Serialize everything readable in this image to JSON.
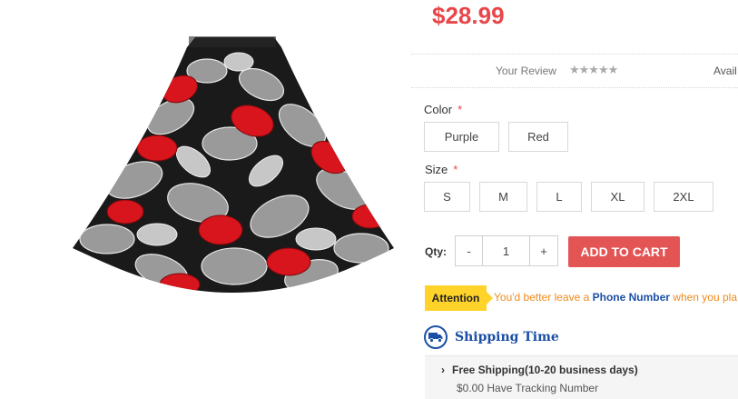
{
  "product": {
    "image_alt": "floral skirt",
    "price": "$28.99",
    "review_label": "Your Review",
    "stars": "★★★★★",
    "availability_prefix": "Avail"
  },
  "options": {
    "color_label": "Color",
    "required_mark": "*",
    "colors": [
      "Purple",
      "Red"
    ],
    "size_label": "Size",
    "sizes": [
      "S",
      "M",
      "L",
      "XL",
      "2XL"
    ]
  },
  "quantity": {
    "label": "Qty:",
    "minus": "-",
    "value": "1",
    "plus": "+"
  },
  "cart": {
    "button_label": "ADD TO CART"
  },
  "attention": {
    "badge": "Attention",
    "text_before": "You'd better leave a ",
    "highlight": "Phone Number",
    "text_after": " when you pla"
  },
  "shipping": {
    "icon": "truck-icon",
    "title": "Shipping Time",
    "line1": "Free Shipping(10-20 business days)",
    "line2": "$0.00 Have Tracking Number"
  },
  "colors": {
    "price": "#e8474a",
    "cart_button": "#e35454",
    "attention_badge": "#ffd32a",
    "attention_text": "#f08a1c",
    "link_blue": "#1b4fa6"
  }
}
